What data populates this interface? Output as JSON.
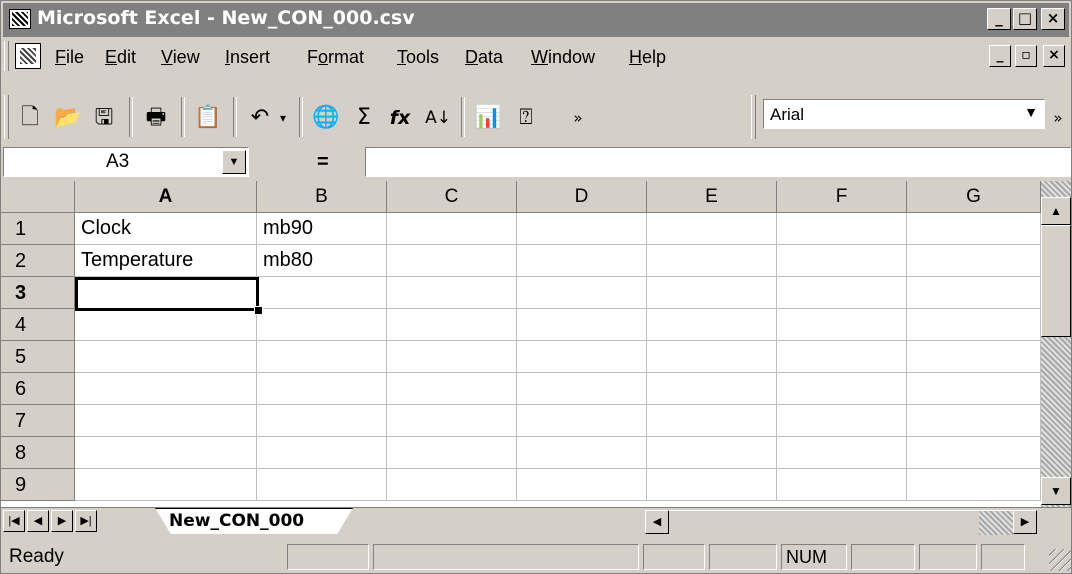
{
  "window": {
    "title": "Microsoft Excel - New_CON_000.csv",
    "buttons": {
      "minimize": "_",
      "maximize": "□",
      "close": "×"
    }
  },
  "menubar": {
    "items": [
      {
        "label": "File",
        "key": "F"
      },
      {
        "label": "Edit",
        "key": "E"
      },
      {
        "label": "View",
        "key": "V"
      },
      {
        "label": "Insert",
        "key": "I"
      },
      {
        "label": "Format",
        "key": "o"
      },
      {
        "label": "Tools",
        "key": "T"
      },
      {
        "label": "Data",
        "key": "D"
      },
      {
        "label": "Window",
        "key": "W"
      },
      {
        "label": "Help",
        "key": "H"
      }
    ]
  },
  "toolbar": {
    "icons": [
      "new-icon",
      "open-icon",
      "save-icon",
      "print-icon",
      "paste-icon",
      "undo-icon",
      "web-icon",
      "autosum-icon",
      "function-icon",
      "sort-ascending-icon",
      "chart-wizard-icon",
      "help-icon",
      "more-buttons-icon"
    ],
    "font": "Arial"
  },
  "formula_bar": {
    "name_box": "A3",
    "equals": "=",
    "content": ""
  },
  "sheet": {
    "columns": [
      "A",
      "B",
      "C",
      "D",
      "E",
      "F",
      "G"
    ],
    "active_column": "A",
    "rows": [
      {
        "n": "1",
        "cells": [
          "Clock",
          "mb90",
          "",
          "",
          "",
          "",
          ""
        ]
      },
      {
        "n": "2",
        "cells": [
          "Temperature",
          "mb80",
          "",
          "",
          "",
          "",
          ""
        ]
      },
      {
        "n": "3",
        "cells": [
          "",
          "",
          "",
          "",
          "",
          "",
          ""
        ]
      },
      {
        "n": "4",
        "cells": [
          "",
          "",
          "",
          "",
          "",
          "",
          ""
        ]
      },
      {
        "n": "5",
        "cells": [
          "",
          "",
          "",
          "",
          "",
          "",
          ""
        ]
      },
      {
        "n": "6",
        "cells": [
          "",
          "",
          "",
          "",
          "",
          "",
          ""
        ]
      },
      {
        "n": "7",
        "cells": [
          "",
          "",
          "",
          "",
          "",
          "",
          ""
        ]
      },
      {
        "n": "8",
        "cells": [
          "",
          "",
          "",
          "",
          "",
          "",
          ""
        ]
      },
      {
        "n": "9",
        "cells": [
          "",
          "",
          "",
          "",
          "",
          "",
          ""
        ]
      }
    ],
    "active_row": "3",
    "active_cell": "A3"
  },
  "tabs": {
    "sheet_name": "New_CON_000"
  },
  "status": {
    "text": "Ready",
    "num": "NUM"
  }
}
